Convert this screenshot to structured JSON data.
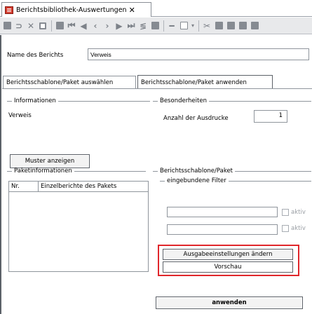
{
  "window": {
    "tab_title": "Berichtsbibliothek-Auswertungen",
    "tab_close_glyph": "✕",
    "tab_icon": "report-icon"
  },
  "toolbar": {
    "icons": [
      "save-icon",
      "refresh-icon",
      "delete-icon",
      "copy-icon",
      "print-icon",
      "first-icon",
      "previous-icon",
      "back-icon",
      "forward-icon",
      "next-icon",
      "last-icon",
      "filter-icon",
      "minus-icon",
      "document-icon",
      "dropdown-icon",
      "scissors-icon",
      "paste-icon",
      "clipboard-icon",
      "layout-icon",
      "settings-icon"
    ]
  },
  "form": {
    "report_name_label": "Name des Berichts",
    "report_name_value": "Verweis"
  },
  "tabs": {
    "select": "Berichtsschablone/Paket auswählen",
    "apply": "Berichtsschablone/Paket anwenden"
  },
  "info": {
    "title": "Informationen",
    "value": "Verweis"
  },
  "special": {
    "title": "Besonderheiten",
    "copies_label": "Anzahl der Ausdrucke",
    "copies_value": "1"
  },
  "buttons": {
    "show_sample": "Muster anzeigen",
    "output_settings": "Ausgabeeinstellungen ändern",
    "preview": "Vorschau",
    "apply": "anwenden"
  },
  "package_info": {
    "title": "Paketinformationen",
    "columns": [
      "Nr.",
      "Einzelberichte des Pakets"
    ]
  },
  "template": {
    "title": "Berichtsschablone/Paket",
    "filters_title": "eingebundene Filter",
    "filter_active_label": "aktiv"
  },
  "colors": {
    "highlight": "#e0262b",
    "accent": "#d33a2c"
  }
}
